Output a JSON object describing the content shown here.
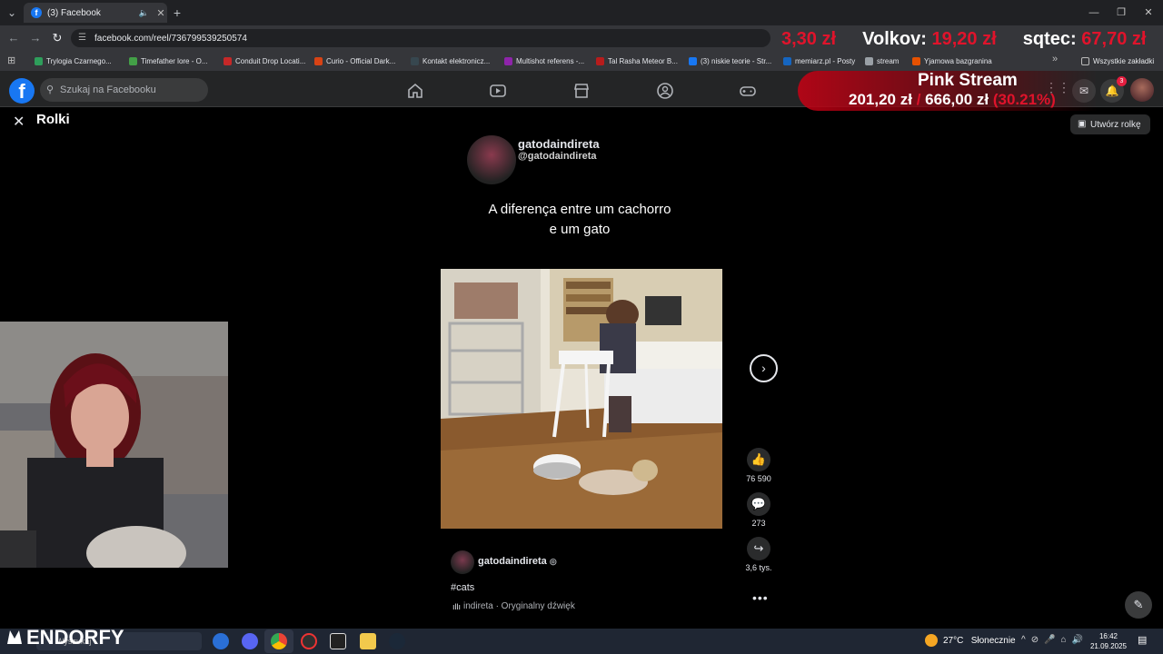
{
  "browser": {
    "tab_title": "(3) Facebook",
    "new_tab": "+",
    "url": "facebook.com/reel/736799539250574",
    "bookmarks": [
      {
        "label": "Trylogia Czarnego...",
        "color": "#2e9e5b"
      },
      {
        "label": "Timefather lore - O...",
        "color": "#43a047"
      },
      {
        "label": "Conduit Drop Locati...",
        "color": "#c62828"
      },
      {
        "label": "Curio - Official Dark...",
        "color": "#d84315"
      },
      {
        "label": "Kontakt elektronicz...",
        "color": "#37474f"
      },
      {
        "label": "Multishot referens -...",
        "color": "#8e24aa"
      },
      {
        "label": "Tal Rasha Meteor B...",
        "color": "#b71c1c"
      },
      {
        "label": "(3) niskie teorie - Str...",
        "color": "#1877f2"
      },
      {
        "label": "memiarz.pl - Posty",
        "color": "#1565c0"
      },
      {
        "label": "stream",
        "color": "#9aa0a6"
      },
      {
        "label": "Yjamowa bazgranina",
        "color": "#e65100"
      }
    ],
    "all_bookmarks": "Wszystkie zakładki"
  },
  "facebook": {
    "search_placeholder": "Szukaj na Facebooku",
    "notifications_count": "3",
    "nav_icons": [
      "home-icon",
      "video-icon",
      "marketplace-icon",
      "groups-icon",
      "gaming-icon"
    ]
  },
  "overlay": {
    "amount1": "3,30 zł",
    "name2": "Volkov:",
    "amount2": "19,20 zł",
    "name3": "sqtec:",
    "amount3": "67,70 zł",
    "pink_title": "Pink Stream",
    "current": "201,20 zł",
    "separator": "/",
    "goal": "666,00 zł",
    "percent": "(30.21%)",
    "accent_color": "#e0132b"
  },
  "reel": {
    "page_title": "Rolki",
    "create_button": "Utwórz rolkę",
    "channel_name": "gatodaindireta",
    "channel_handle": "@gatodaindireta",
    "caption_line1": "A diferença entre um cachorro",
    "caption_line2": "e um gato",
    "likes": "76 590",
    "comments": "273",
    "shares": "3,6 tys.",
    "author": "gatodaindireta",
    "hashtag": "#cats",
    "audio": "indireta · Oryginalny dźwięk"
  },
  "taskbar": {
    "brand": "ENDORFY",
    "search_placeholder": "Wyszukaj",
    "temperature": "27°C",
    "weather": "Słonecznie",
    "time": "16:42",
    "date": "21.09.2025"
  }
}
